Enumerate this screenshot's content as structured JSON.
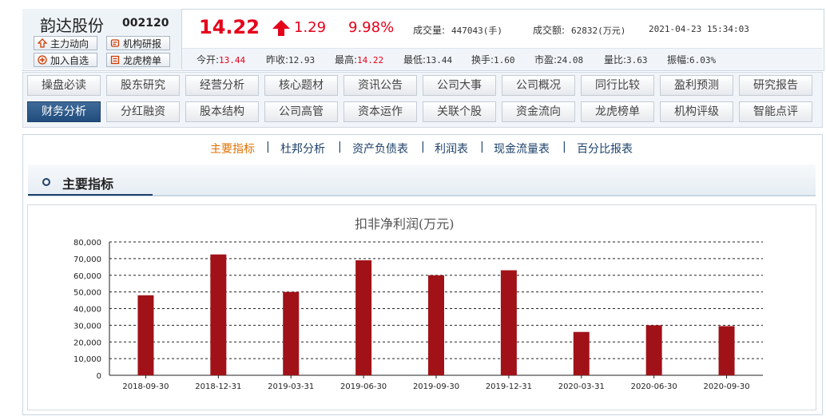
{
  "stock": {
    "name": "韵达股份",
    "code": "002120",
    "buttons": [
      "主力动向",
      "机构研报",
      "加入自选",
      "龙虎榜单"
    ],
    "price": "14.22",
    "change": "1.29",
    "change_pct": "9.98%",
    "volume_label": "成交量:",
    "volume": "447043(手)",
    "amount_label": "成交额:",
    "amount": "62832(万元)",
    "datetime": "2021-04-23 15:34:03",
    "stats": [
      {
        "label": "今开:",
        "value": "13.44",
        "color": "#e5001a"
      },
      {
        "label": "昨收:",
        "value": "12.93",
        "color": "#333333"
      },
      {
        "label": "最高:",
        "value": "14.22",
        "color": "#e5001a"
      },
      {
        "label": "最低:",
        "value": "13.44",
        "color": "#333333"
      },
      {
        "label": "换手:",
        "value": "1.60",
        "color": "#333333"
      },
      {
        "label": "市盈:",
        "value": "24.08",
        "color": "#333333"
      },
      {
        "label": "量比:",
        "value": "3.63",
        "color": "#333333"
      },
      {
        "label": "振幅:",
        "value": "6.03%",
        "color": "#333333"
      }
    ]
  },
  "nav": {
    "row1": [
      "操盘必读",
      "股东研究",
      "经营分析",
      "核心题材",
      "资讯公告",
      "公司大事",
      "公司概况",
      "同行比较",
      "盈利预测",
      "研究报告"
    ],
    "row2": [
      "财务分析",
      "分红融资",
      "股本结构",
      "公司高管",
      "资本运作",
      "关联个股",
      "资金流向",
      "龙虎榜单",
      "机构评级",
      "智能点评"
    ],
    "active": "财务分析"
  },
  "subtabs": {
    "items": [
      "主要指标",
      "杜邦分析",
      "资产负债表",
      "利润表",
      "现金流量表",
      "百分比报表"
    ],
    "active": "主要指标"
  },
  "section_title": "主要指标",
  "colors": {
    "accent": "#e5001a",
    "bar": "#a11218",
    "nav_active": "#214d7e",
    "subtab_active": "#e07000"
  },
  "chart_data": {
    "type": "bar",
    "title": "扣非净利润(万元)",
    "categories": [
      "2018-09-30",
      "2018-12-31",
      "2019-03-31",
      "2019-06-30",
      "2019-09-30",
      "2019-12-31",
      "2020-03-31",
      "2020-06-30",
      "2020-09-30"
    ],
    "values": [
      48000,
      72500,
      50000,
      69000,
      60000,
      63000,
      26000,
      30000,
      29500
    ],
    "yticks": [
      "0",
      "10,000",
      "20,000",
      "30,000",
      "40,000",
      "50,000",
      "60,000",
      "70,000",
      "80,000"
    ],
    "ylim": [
      0,
      80000
    ],
    "grid": true
  }
}
